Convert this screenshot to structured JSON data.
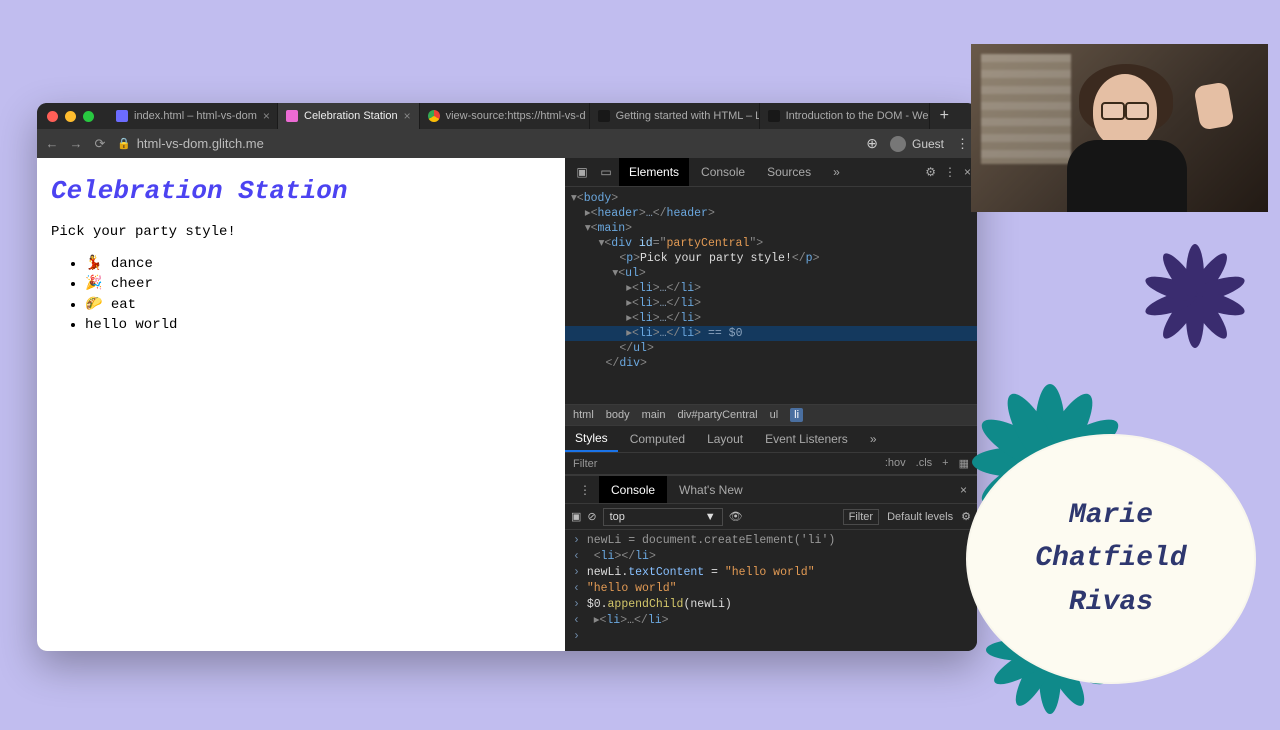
{
  "tabs": [
    {
      "label": "index.html – html-vs-dom",
      "favicon": "fav-glitch"
    },
    {
      "label": "Celebration Station",
      "favicon": "fav-party"
    },
    {
      "label": "view-source:https://html-vs-d",
      "favicon": "fav-chrome"
    },
    {
      "label": "Getting started with HTML – Le",
      "favicon": "fav-mdn"
    },
    {
      "label": "Introduction to the DOM - Web",
      "favicon": "fav-mdn"
    }
  ],
  "address": {
    "url": "html-vs-dom.glitch.me",
    "user": "Guest"
  },
  "page": {
    "title": "Celebration Station",
    "prompt": "Pick your party style!",
    "items": [
      {
        "emoji": "💃",
        "text": "dance"
      },
      {
        "emoji": "🎉",
        "text": "cheer"
      },
      {
        "emoji": "🌮",
        "text": "eat"
      },
      {
        "emoji": "",
        "text": "hello world"
      }
    ]
  },
  "devtools": {
    "tabs": [
      "Elements",
      "Console",
      "Sources"
    ],
    "tree": {
      "body": "<body>",
      "header": "<header>…</header>",
      "main": "<main>",
      "divOpen": "<div id=\"partyCentral\">",
      "p": "<p>Pick your party style!</p>",
      "ulOpen": "<ul>",
      "li": "<li>…</li>",
      "selected_suffix": " == $0",
      "ulClose": "</ul>",
      "divClose": "</div>"
    },
    "crumbs": [
      "html",
      "body",
      "main",
      "div#partyCentral",
      "ul",
      "li"
    ],
    "style_tabs": [
      "Styles",
      "Computed",
      "Layout",
      "Event Listeners"
    ],
    "filter": {
      "placeholder": "Filter",
      "hov": ":hov",
      "cls": ".cls"
    }
  },
  "drawer": {
    "tabs": [
      "Console",
      "What's New"
    ],
    "top_select": "top",
    "filter": "Filter",
    "levels": "Default levels",
    "lines": {
      "l1": "newLi = document.createElement('li')",
      "l2": "<li></li>",
      "l3_a": "newLi.",
      "l3_b": "textContent",
      "l3_c": " = ",
      "l3_d": "\"hello world\"",
      "l4": "\"hello world\"",
      "l5_a": "$0.",
      "l5_b": "appendChild",
      "l5_c": "(newLi)",
      "l6": "<li>…</li>"
    }
  },
  "presenter": {
    "line1": "Marie",
    "line2": "Chatfield",
    "line3": "Rivas"
  }
}
